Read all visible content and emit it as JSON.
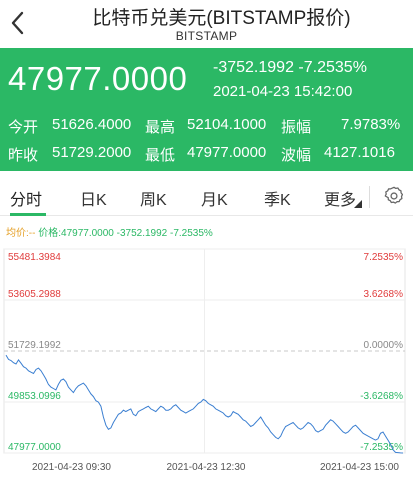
{
  "header": {
    "title": "比特币兑美元(BITSTAMP报价)",
    "subtitle": "BITSTAMP"
  },
  "quote": {
    "last_price": "47977.0000",
    "change": "-3752.1992",
    "change_pct": "-7.2535%",
    "datetime": "2021-04-23 15:42:00",
    "open_label": "今开",
    "open": "51626.4000",
    "high_label": "最高",
    "high": "52104.1000",
    "amplitude_label": "振幅",
    "amplitude": "7.9783%",
    "prev_close_label": "昨收",
    "prev_close": "51729.2000",
    "low_label": "最低",
    "low": "47977.0000",
    "range_label": "波幅",
    "range": "4127.1016",
    "bg_color": "#2bb865"
  },
  "tabs": [
    {
      "label": "分时",
      "active": true
    },
    {
      "label": "日K"
    },
    {
      "label": "周K"
    },
    {
      "label": "月K"
    },
    {
      "label": "季K"
    },
    {
      "label": "更多"
    }
  ],
  "tab_icons": {
    "more": "search-icon",
    "settings": "gear-icon"
  },
  "avg_bar": {
    "label": "均价:--",
    "rest": "价格:47977.0000 -3752.1992 -7.2535%"
  },
  "chart_data": {
    "type": "line",
    "y_left_labels": [
      "55481.3984",
      "53605.2988",
      "51729.1992",
      "49853.0996",
      "47977.0000"
    ],
    "y_right_labels": [
      "7.2535%",
      "3.6268%",
      "0.0000%",
      "-3.6268%",
      "-7.2535%"
    ],
    "x_labels": [
      "2021-04-23 09:30",
      "2021-04-23 12:30",
      "2021-04-23 15:00"
    ],
    "ylim": [
      47977.0,
      55481.3984
    ],
    "reference": 51729.1992,
    "line_color": "#3b7fd1",
    "colors": {
      "up": "#e03c3c",
      "flat": "#888888",
      "down": "#2bb865"
    },
    "series": [
      {
        "values": [
          51580,
          51420,
          51380,
          51300,
          51250,
          51400,
          51280,
          51150,
          51100,
          51000,
          50950,
          50900,
          51050,
          51100,
          51000,
          50850,
          50700,
          50500,
          50400,
          50350,
          50300,
          50500,
          50650,
          50700,
          50600,
          50400,
          50300,
          50200,
          50350,
          50450,
          50500,
          50550,
          50450,
          50300,
          50150,
          50050,
          49900,
          49850,
          49700,
          49300,
          49000,
          48850,
          48900,
          49100,
          49250,
          49400,
          49450,
          49550,
          49500,
          49550,
          49600,
          49400,
          49350,
          49500,
          49550,
          49600,
          49650,
          49700,
          49600,
          49550,
          49500,
          49600,
          49700,
          49650,
          49550,
          49550,
          49600,
          49700,
          49750,
          49650,
          49550,
          49500,
          49450,
          49500,
          49550,
          49600,
          49700,
          49800,
          49850,
          49950,
          49900,
          49800,
          49750,
          49700,
          49600,
          49550,
          49500,
          49450,
          49350,
          49300,
          49350,
          49500,
          49450,
          49400,
          49300,
          49200,
          49150,
          49050,
          48950,
          49000,
          49100,
          49200,
          49300,
          49150,
          49000,
          48900,
          48750,
          48650,
          48550,
          48500,
          48600,
          48800,
          48950,
          49000,
          49050,
          49100,
          49000,
          48900,
          48850,
          48900,
          49000,
          49100,
          49050,
          48950,
          48800,
          48750,
          48800,
          48850,
          49000,
          49100,
          49200,
          49150,
          49050,
          48950,
          48850,
          48750,
          48700,
          48750,
          48850,
          48950,
          49000,
          48900,
          48800,
          48700,
          48650,
          48600,
          48550,
          48500,
          48450,
          48500,
          48700,
          48750,
          48600,
          48450,
          48300,
          48100,
          48000,
          47990,
          47980,
          47977
        ]
      }
    ]
  }
}
